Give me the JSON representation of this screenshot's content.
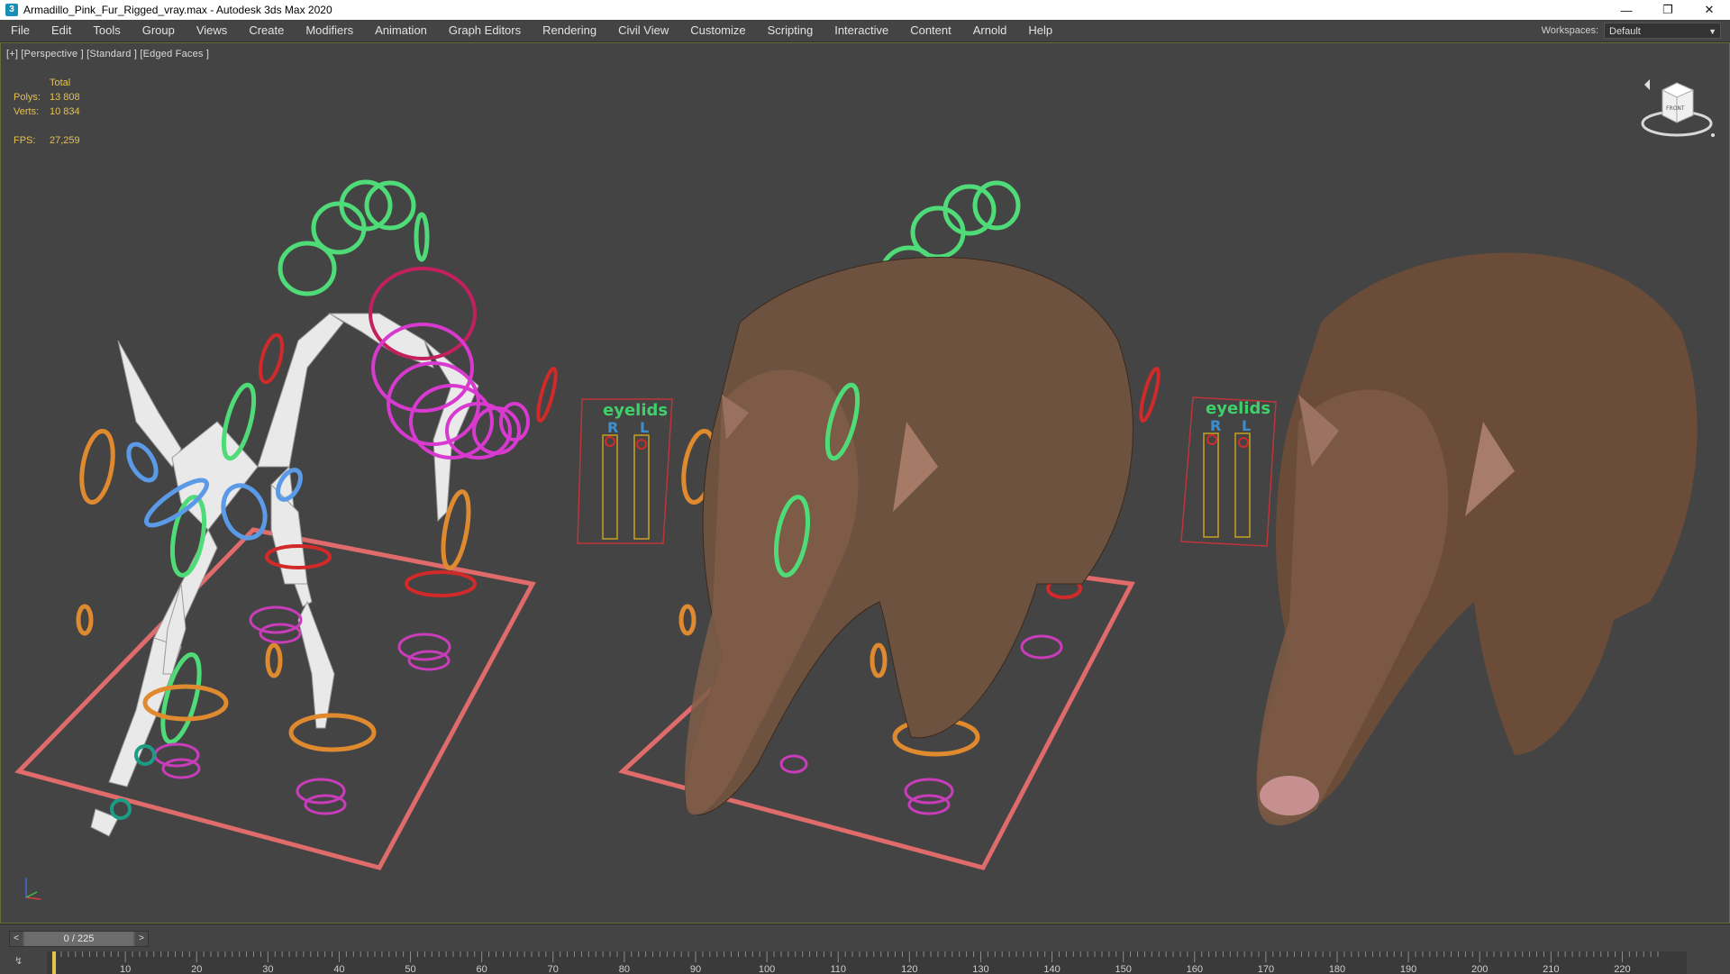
{
  "window": {
    "title": "Armadillo_Pink_Fur_Rigged_vray.max - Autodesk 3ds Max 2020",
    "app_icon": "3",
    "minimize": "—",
    "restore": "❐",
    "close": "✕"
  },
  "menu": {
    "items": [
      {
        "label": "File"
      },
      {
        "label": "Edit"
      },
      {
        "label": "Tools"
      },
      {
        "label": "Group"
      },
      {
        "label": "Views"
      },
      {
        "label": "Create"
      },
      {
        "label": "Modifiers"
      },
      {
        "label": "Animation"
      },
      {
        "label": "Graph Editors"
      },
      {
        "label": "Rendering"
      },
      {
        "label": "Civil View"
      },
      {
        "label": "Customize"
      },
      {
        "label": "Scripting"
      },
      {
        "label": "Interactive"
      },
      {
        "label": "Content"
      },
      {
        "label": "Arnold"
      },
      {
        "label": "Help"
      }
    ]
  },
  "workspace": {
    "label": "Workspaces:",
    "value": "Default"
  },
  "viewport": {
    "label": "[+] [Perspective ] [Standard ] [Edged Faces ]",
    "stats": {
      "header": "Total",
      "polys_label": "Polys:",
      "polys": "13 808",
      "verts_label": "Verts:",
      "verts": "10 834",
      "fps_label": "FPS:",
      "fps": "27,259"
    },
    "viewcube_face": "FRONT",
    "panels": {
      "eyelids": "eyelids",
      "r": "R",
      "l": "L"
    }
  },
  "timeline": {
    "frame_display": "0 / 225",
    "prev": "<",
    "next": ">",
    "track_icon": "↯",
    "ruler_labels": [
      "10",
      "20",
      "30",
      "40",
      "50",
      "60",
      "70",
      "80",
      "90",
      "100",
      "110",
      "120",
      "130",
      "140",
      "150",
      "160",
      "170",
      "180",
      "190",
      "200",
      "210",
      "220"
    ]
  },
  "colors": {
    "viewport_bg": "#444444",
    "accent_yellow": "#e6c14d",
    "floor_rect": "#e06b6b",
    "ring_green": "#4fdc78",
    "ring_orange": "#e08a30",
    "ring_blue": "#5a9ae6",
    "ring_magenta": "#d83ad0",
    "ring_red": "#d22a2a"
  }
}
